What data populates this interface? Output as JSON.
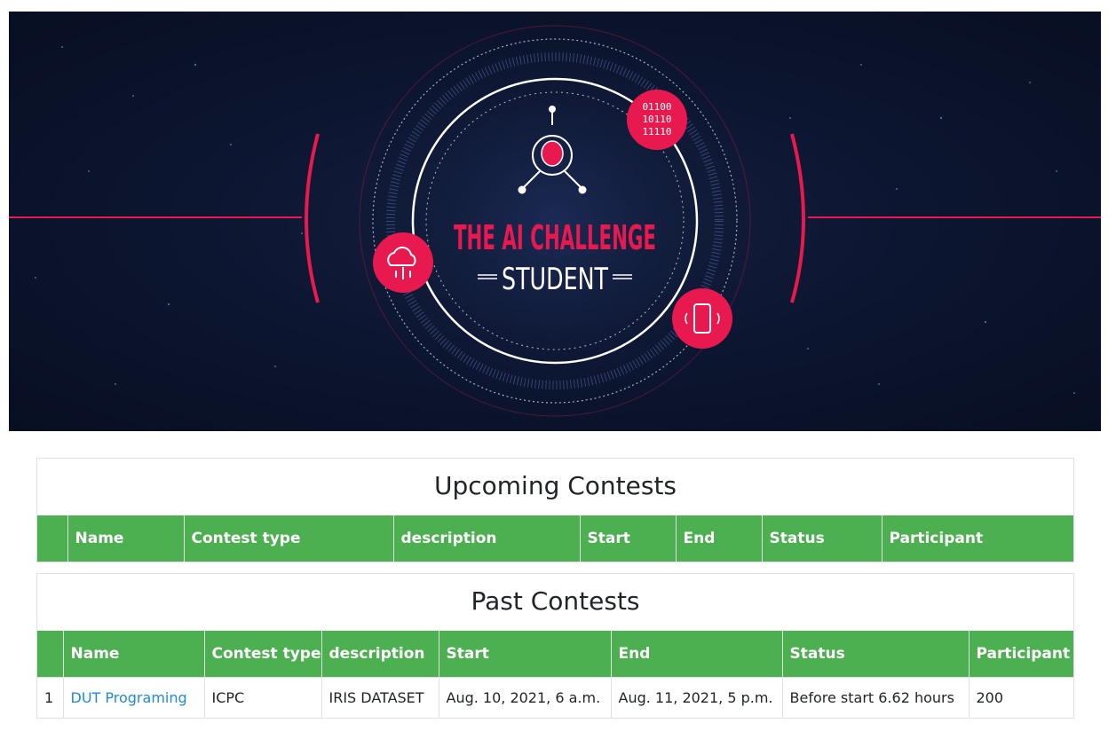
{
  "banner": {
    "title": "THE AI CHALLENGE",
    "subtitle": "STUDENT",
    "binary_badge": [
      "01100",
      "10110",
      "11110"
    ],
    "colors": {
      "accent": "#e8194e",
      "background": "#0d1631",
      "title": "#e8194e",
      "subtitle": "#ffffff"
    },
    "icons": [
      "brain-icon",
      "cloud-icon",
      "phone-icon"
    ]
  },
  "upcoming": {
    "title": "Upcoming Contests",
    "headers": [
      "",
      "Name",
      "Contest type",
      "description",
      "Start",
      "End",
      "Status",
      "Participant"
    ]
  },
  "past": {
    "title": "Past Contests",
    "headers": [
      "",
      "Name",
      "Contest type",
      "description",
      "Start",
      "End",
      "Status",
      "Participant"
    ],
    "rows": [
      {
        "index": "1",
        "name": "DUT Programing",
        "contest_type": "ICPC",
        "description": "IRIS DATASET",
        "start": "Aug. 10, 2021, 6 a.m.",
        "end": "Aug. 11, 2021, 5 p.m.",
        "status": "Before start 6.62 hours",
        "participant": "200"
      }
    ]
  },
  "colors": {
    "header_bg": "#4caf50",
    "link": "#1e88e5"
  }
}
